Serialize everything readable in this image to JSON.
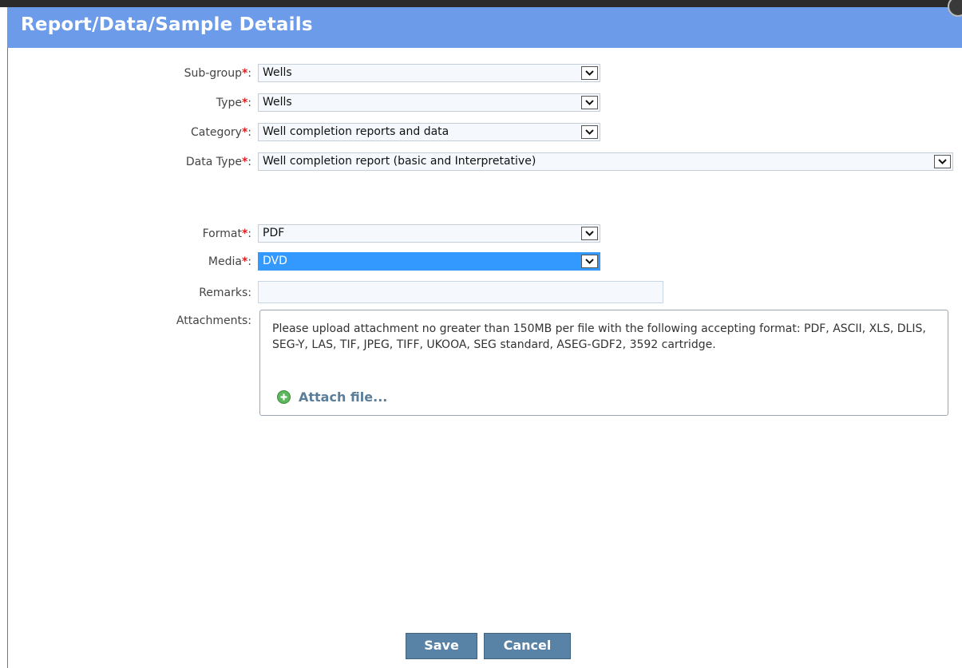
{
  "dialog": {
    "title": "Report/Data/Sample Details"
  },
  "fields": {
    "subgroup": {
      "label": "Sub-group",
      "required_mark": "*",
      "suffix": ":",
      "value": "Wells"
    },
    "type": {
      "label": "Type",
      "required_mark": "*",
      "suffix": ":",
      "value": "Wells"
    },
    "category": {
      "label": "Category",
      "required_mark": "*",
      "suffix": ":",
      "value": "Well completion reports and data"
    },
    "datatype": {
      "label": "Data Type",
      "required_mark": "*",
      "suffix": ":",
      "value": "Well completion report (basic and Interpretative)"
    },
    "format": {
      "label": "Format",
      "required_mark": "*",
      "suffix": ":",
      "value": "PDF"
    },
    "media": {
      "label": "Media",
      "required_mark": "*",
      "suffix": ":",
      "value": "DVD"
    },
    "remarks": {
      "label": "Remarks:",
      "value": ""
    },
    "attachments": {
      "label": "Attachments:",
      "instructions": "Please upload attachment no greater than 150MB per file with the following accepting format: PDF, ASCII, XLS, DLIS, SEG-Y, LAS, TIF, JPEG, TIFF, UKOOA, SEG standard, ASEG-GDF2, 3592 cartridge.",
      "attach_link": "Attach file..."
    }
  },
  "buttons": {
    "save": "Save",
    "cancel": "Cancel"
  },
  "icons": {
    "dropdown": "chevron-down-icon",
    "attach": "plus-circle-icon",
    "close": "close-icon"
  },
  "colors": {
    "title_bar": "#6b9be9",
    "required": "#e02020",
    "selected_highlight": "#3399ff",
    "button": "#5983a6",
    "link": "#5a7d9a"
  }
}
